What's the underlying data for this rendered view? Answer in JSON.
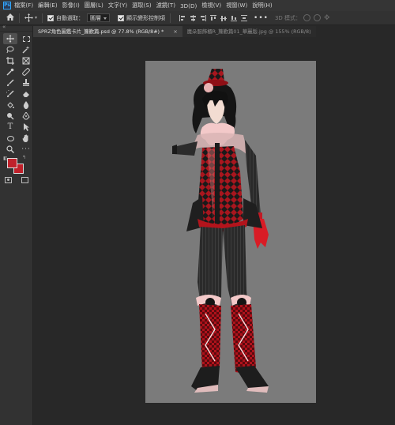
{
  "menu": {
    "logo": "Ps",
    "items": [
      "檔案(F)",
      "編輯(E)",
      "影像(I)",
      "圖層(L)",
      "文字(Y)",
      "選取(S)",
      "濾鏡(T)",
      "3D(D)",
      "檢視(V)",
      "視窗(W)",
      "說明(H)"
    ]
  },
  "options": {
    "auto_select_label": "自動選取：",
    "auto_select_value": "圖層",
    "show_transform_label": "顯示變形控制項",
    "mode_3d_label": "3D 模式：",
    "more_label": "•••"
  },
  "tools_header": "«",
  "tabs": [
    {
      "label": "SPRZ角色圖鑑卡片_簾歡篇.psd @ 77.8% (RGB/8#) *",
      "close": "×"
    },
    {
      "label": "魔朵服飾櫃R_簾歡篇01_華麗版.jpg @ 155% (RGB/8)"
    }
  ],
  "colors": {
    "accent": "#31a8ff",
    "foreground": "#c0212b",
    "background": "#c0212b",
    "document_bg": "#7b7b7b"
  }
}
